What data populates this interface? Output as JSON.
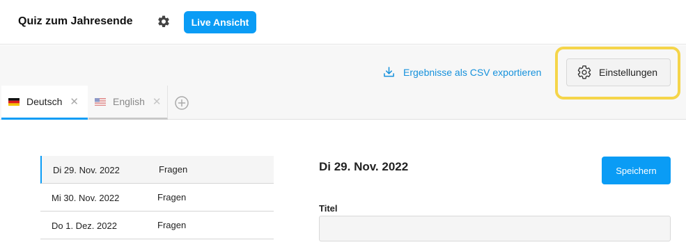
{
  "header": {
    "title": "Quiz zum Jahresende",
    "settings_icon": "gear-icon",
    "live_button": "Live Ansicht"
  },
  "toolbar": {
    "export_label": "Ergebnisse als CSV exportieren",
    "export_icon": "download-icon",
    "settings_label": "Einstellungen",
    "settings_icon": "gear-icon"
  },
  "languages": {
    "tabs": [
      {
        "label": "Deutsch",
        "flag": "flag-de-icon",
        "active": true
      },
      {
        "label": "English",
        "flag": "flag-us-icon",
        "active": false
      }
    ],
    "add_icon": "plus-circle-icon"
  },
  "days": [
    {
      "date": "Di 29. Nov. 2022",
      "type": "Fragen",
      "selected": true
    },
    {
      "date": "Mi 30. Nov. 2022",
      "type": "Fragen",
      "selected": false
    },
    {
      "date": "Do 1. Dez. 2022",
      "type": "Fragen",
      "selected": false
    }
  ],
  "detail": {
    "title": "Di 29. Nov. 2022",
    "save_label": "Speichern",
    "field_label": "Titel",
    "field_value": ""
  },
  "colors": {
    "accent": "#0a9cf5",
    "link": "#1591dc",
    "highlight": "#f5d54a"
  }
}
